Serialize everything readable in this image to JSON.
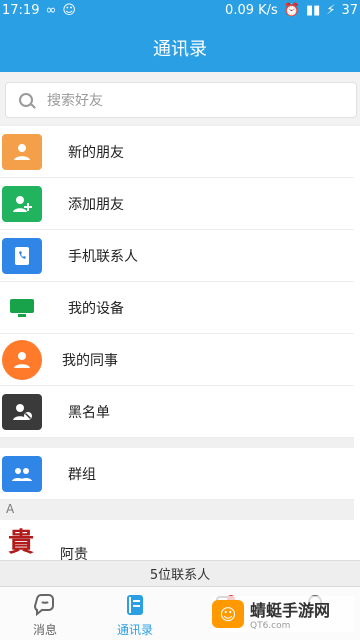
{
  "status": {
    "time": "17:19",
    "infinity": "∞",
    "speed": "0.09 K/s",
    "battery": "37"
  },
  "title": "通讯录",
  "search": {
    "placeholder": "搜索好友"
  },
  "menu": [
    {
      "label": "新的朋友",
      "color": "#f4a04b",
      "icon": "new-friend-icon"
    },
    {
      "label": "添加朋友",
      "color": "#22b35f",
      "icon": "add-friend-icon"
    },
    {
      "label": "手机联系人",
      "color": "#2f86e6",
      "icon": "phone-contacts-icon"
    },
    {
      "label": "我的设备",
      "color": "#18a34a",
      "icon": "device-icon"
    },
    {
      "label": "我的同事",
      "color": "#ff7a2a",
      "icon": "colleague-icon"
    },
    {
      "label": "黑名单",
      "color": "#3a3a3a",
      "icon": "blacklist-icon"
    }
  ],
  "groups": {
    "label": "群组",
    "color": "#2f86e6"
  },
  "section_letter": "A",
  "contact": {
    "name": "阿贵",
    "avatar_text": "貴"
  },
  "count_text": "5位联系人",
  "tabs": [
    {
      "label": "消息",
      "active": false,
      "icon": "chat-bubble-icon"
    },
    {
      "label": "通讯录",
      "active": true,
      "icon": "contacts-book-icon"
    }
  ],
  "watermark": {
    "title": "蜻蜓手游网",
    "site": "QT6.com"
  }
}
